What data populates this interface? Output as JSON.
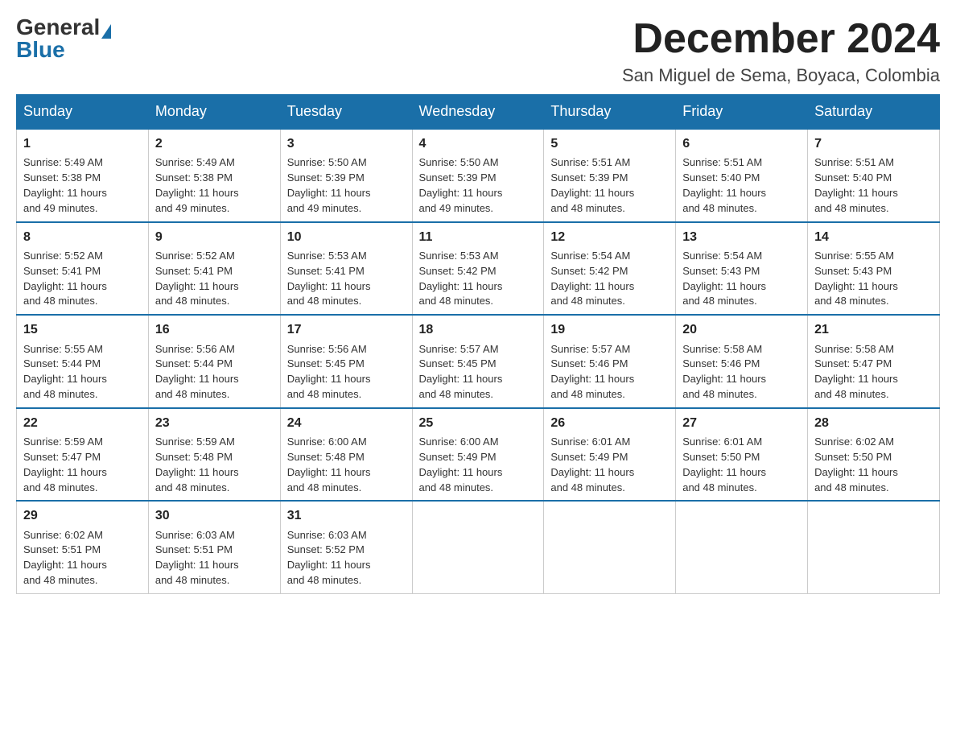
{
  "logo": {
    "general": "General",
    "blue": "Blue"
  },
  "title": "December 2024",
  "location": "San Miguel de Sema, Boyaca, Colombia",
  "days_of_week": [
    "Sunday",
    "Monday",
    "Tuesday",
    "Wednesday",
    "Thursday",
    "Friday",
    "Saturday"
  ],
  "weeks": [
    [
      {
        "day": "1",
        "sunrise": "5:49 AM",
        "sunset": "5:38 PM",
        "daylight": "11 hours and 49 minutes."
      },
      {
        "day": "2",
        "sunrise": "5:49 AM",
        "sunset": "5:38 PM",
        "daylight": "11 hours and 49 minutes."
      },
      {
        "day": "3",
        "sunrise": "5:50 AM",
        "sunset": "5:39 PM",
        "daylight": "11 hours and 49 minutes."
      },
      {
        "day": "4",
        "sunrise": "5:50 AM",
        "sunset": "5:39 PM",
        "daylight": "11 hours and 49 minutes."
      },
      {
        "day": "5",
        "sunrise": "5:51 AM",
        "sunset": "5:39 PM",
        "daylight": "11 hours and 48 minutes."
      },
      {
        "day": "6",
        "sunrise": "5:51 AM",
        "sunset": "5:40 PM",
        "daylight": "11 hours and 48 minutes."
      },
      {
        "day": "7",
        "sunrise": "5:51 AM",
        "sunset": "5:40 PM",
        "daylight": "11 hours and 48 minutes."
      }
    ],
    [
      {
        "day": "8",
        "sunrise": "5:52 AM",
        "sunset": "5:41 PM",
        "daylight": "11 hours and 48 minutes."
      },
      {
        "day": "9",
        "sunrise": "5:52 AM",
        "sunset": "5:41 PM",
        "daylight": "11 hours and 48 minutes."
      },
      {
        "day": "10",
        "sunrise": "5:53 AM",
        "sunset": "5:41 PM",
        "daylight": "11 hours and 48 minutes."
      },
      {
        "day": "11",
        "sunrise": "5:53 AM",
        "sunset": "5:42 PM",
        "daylight": "11 hours and 48 minutes."
      },
      {
        "day": "12",
        "sunrise": "5:54 AM",
        "sunset": "5:42 PM",
        "daylight": "11 hours and 48 minutes."
      },
      {
        "day": "13",
        "sunrise": "5:54 AM",
        "sunset": "5:43 PM",
        "daylight": "11 hours and 48 minutes."
      },
      {
        "day": "14",
        "sunrise": "5:55 AM",
        "sunset": "5:43 PM",
        "daylight": "11 hours and 48 minutes."
      }
    ],
    [
      {
        "day": "15",
        "sunrise": "5:55 AM",
        "sunset": "5:44 PM",
        "daylight": "11 hours and 48 minutes."
      },
      {
        "day": "16",
        "sunrise": "5:56 AM",
        "sunset": "5:44 PM",
        "daylight": "11 hours and 48 minutes."
      },
      {
        "day": "17",
        "sunrise": "5:56 AM",
        "sunset": "5:45 PM",
        "daylight": "11 hours and 48 minutes."
      },
      {
        "day": "18",
        "sunrise": "5:57 AM",
        "sunset": "5:45 PM",
        "daylight": "11 hours and 48 minutes."
      },
      {
        "day": "19",
        "sunrise": "5:57 AM",
        "sunset": "5:46 PM",
        "daylight": "11 hours and 48 minutes."
      },
      {
        "day": "20",
        "sunrise": "5:58 AM",
        "sunset": "5:46 PM",
        "daylight": "11 hours and 48 minutes."
      },
      {
        "day": "21",
        "sunrise": "5:58 AM",
        "sunset": "5:47 PM",
        "daylight": "11 hours and 48 minutes."
      }
    ],
    [
      {
        "day": "22",
        "sunrise": "5:59 AM",
        "sunset": "5:47 PM",
        "daylight": "11 hours and 48 minutes."
      },
      {
        "day": "23",
        "sunrise": "5:59 AM",
        "sunset": "5:48 PM",
        "daylight": "11 hours and 48 minutes."
      },
      {
        "day": "24",
        "sunrise": "6:00 AM",
        "sunset": "5:48 PM",
        "daylight": "11 hours and 48 minutes."
      },
      {
        "day": "25",
        "sunrise": "6:00 AM",
        "sunset": "5:49 PM",
        "daylight": "11 hours and 48 minutes."
      },
      {
        "day": "26",
        "sunrise": "6:01 AM",
        "sunset": "5:49 PM",
        "daylight": "11 hours and 48 minutes."
      },
      {
        "day": "27",
        "sunrise": "6:01 AM",
        "sunset": "5:50 PM",
        "daylight": "11 hours and 48 minutes."
      },
      {
        "day": "28",
        "sunrise": "6:02 AM",
        "sunset": "5:50 PM",
        "daylight": "11 hours and 48 minutes."
      }
    ],
    [
      {
        "day": "29",
        "sunrise": "6:02 AM",
        "sunset": "5:51 PM",
        "daylight": "11 hours and 48 minutes."
      },
      {
        "day": "30",
        "sunrise": "6:03 AM",
        "sunset": "5:51 PM",
        "daylight": "11 hours and 48 minutes."
      },
      {
        "day": "31",
        "sunrise": "6:03 AM",
        "sunset": "5:52 PM",
        "daylight": "11 hours and 48 minutes."
      },
      null,
      null,
      null,
      null
    ]
  ],
  "labels": {
    "sunrise": "Sunrise:",
    "sunset": "Sunset:",
    "daylight": "Daylight:"
  }
}
